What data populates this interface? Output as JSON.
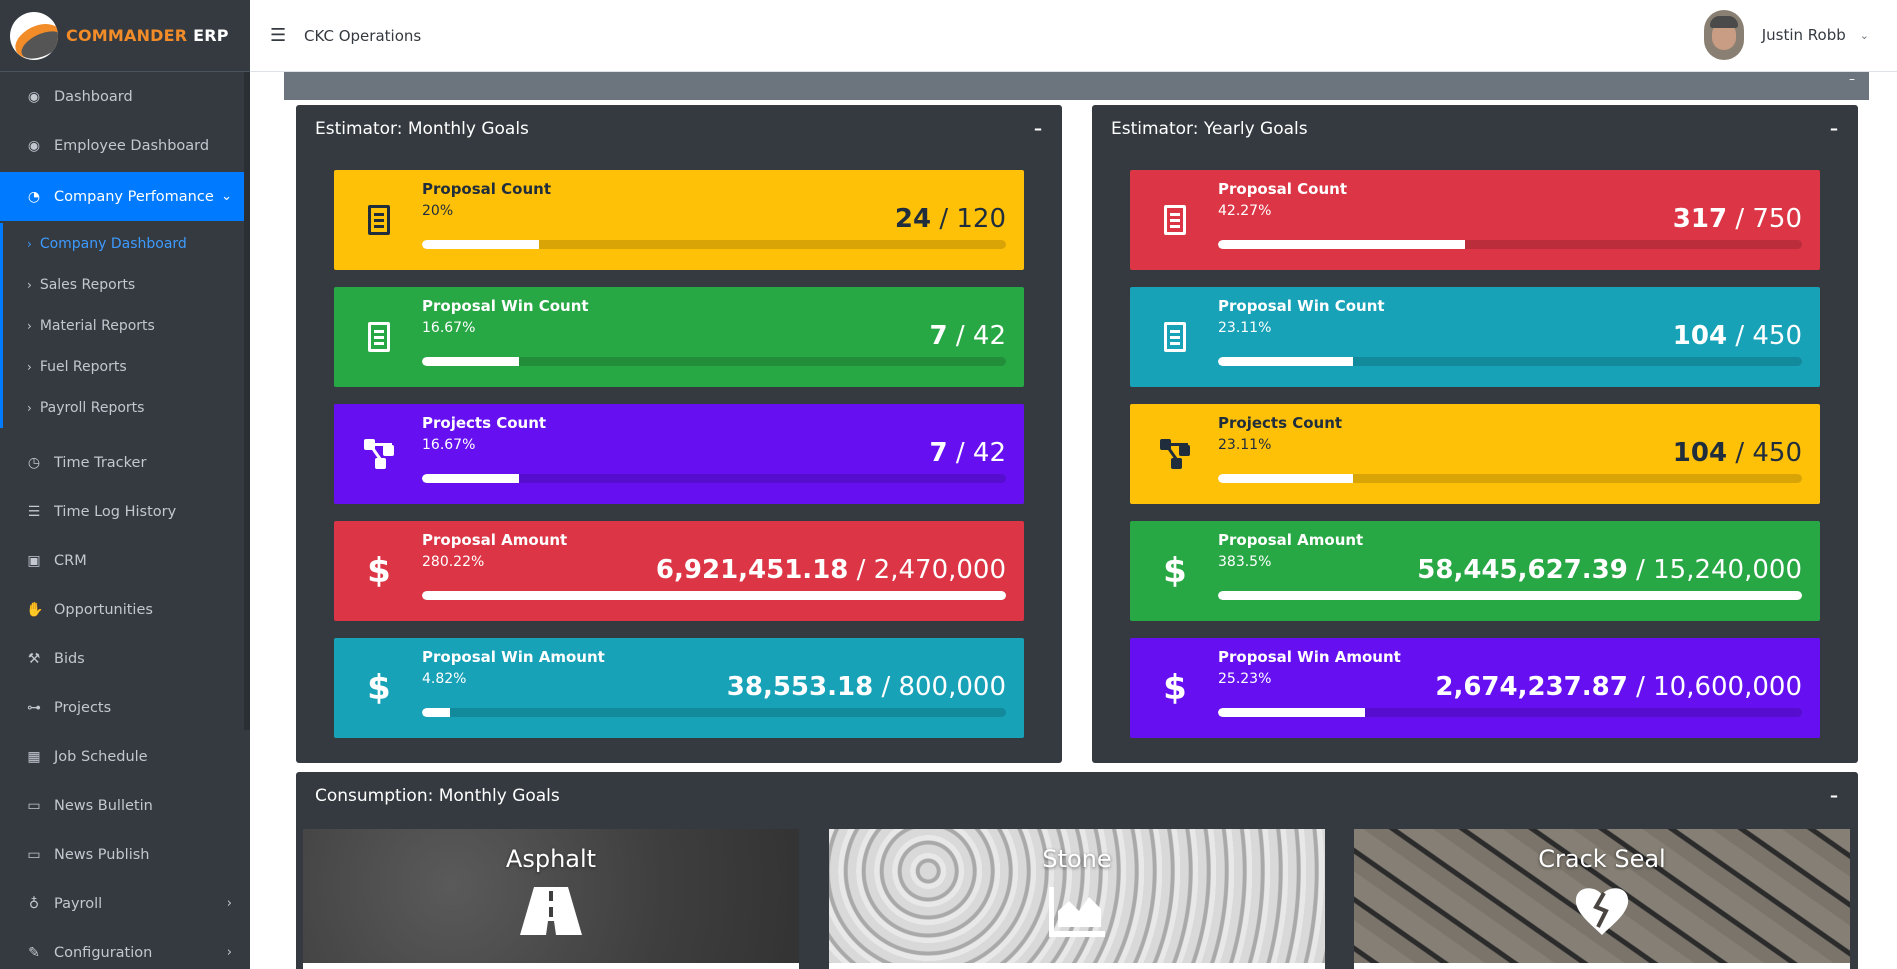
{
  "brand": {
    "name_primary": "COMMANDER",
    "name_secondary": "ERP"
  },
  "header": {
    "menu_icon": "hamburger-icon",
    "title": "CKC Operations",
    "user_name": "Justin Robb"
  },
  "sidebar": {
    "items": [
      {
        "label": "Dashboard",
        "icon": "dashboard-icon"
      },
      {
        "label": "Employee Dashboard",
        "icon": "dashboard-icon"
      },
      {
        "label": "Company Perfomance",
        "icon": "pie-chart-icon",
        "active": true
      },
      {
        "label": "Time Tracker",
        "icon": "clock-icon"
      },
      {
        "label": "Time Log History",
        "icon": "list-icon"
      },
      {
        "label": "CRM",
        "icon": "briefcase-icon"
      },
      {
        "label": "Opportunities",
        "icon": "handshake-icon"
      },
      {
        "label": "Bids",
        "icon": "gavel-icon"
      },
      {
        "label": "Projects",
        "icon": "project-diagram-icon"
      },
      {
        "label": "Job Schedule",
        "icon": "calendar-icon"
      },
      {
        "label": "News Bulletin",
        "icon": "desktop-icon"
      },
      {
        "label": "News Publish",
        "icon": "desktop-icon"
      },
      {
        "label": "Payroll",
        "icon": "money-bag-icon"
      },
      {
        "label": "Configuration",
        "icon": "wrench-icon"
      }
    ],
    "subitems": [
      {
        "label": "Company Dashboard",
        "active": true
      },
      {
        "label": "Sales Reports"
      },
      {
        "label": "Material Reports"
      },
      {
        "label": "Fuel Reports"
      },
      {
        "label": "Payroll Reports"
      }
    ]
  },
  "monthly": {
    "title": "Estimator: Monthly Goals",
    "minimize": "–",
    "goals": [
      {
        "name": "Proposal Count",
        "pct": "20%",
        "current": "24",
        "target": "120",
        "sep": "/",
        "progress": 0.2,
        "color": "#ffc107",
        "icon": "receipt-icon"
      },
      {
        "name": "Proposal Win Count",
        "pct": "16.67%",
        "current": "7",
        "target": "42",
        "sep": "/",
        "progress": 0.1667,
        "color": "#28a745",
        "icon": "receipt-icon"
      },
      {
        "name": "Projects Count",
        "pct": "16.67%",
        "current": "7",
        "target": "42",
        "sep": "/",
        "progress": 0.1667,
        "color": "#6610f2",
        "icon": "project-diagram-icon"
      },
      {
        "name": "Proposal Amount",
        "pct": "280.22%",
        "current": "6,921,451.18",
        "target": "2,470,000",
        "sep": "/",
        "progress": 1.0,
        "color": "#dc3545",
        "icon": "dollar-icon"
      },
      {
        "name": "Proposal Win Amount",
        "pct": "4.82%",
        "current": "38,553.18",
        "target": "800,000",
        "sep": "/",
        "progress": 0.0482,
        "color": "#17a2b8",
        "icon": "dollar-icon"
      }
    ]
  },
  "yearly": {
    "title": "Estimator: Yearly Goals",
    "minimize": "–",
    "goals": [
      {
        "name": "Proposal Count",
        "pct": "42.27%",
        "current": "317",
        "target": "750",
        "sep": "/",
        "progress": 0.4227,
        "color": "#dc3545",
        "icon": "receipt-icon"
      },
      {
        "name": "Proposal Win Count",
        "pct": "23.11%",
        "current": "104",
        "target": "450",
        "sep": "/",
        "progress": 0.2311,
        "color": "#17a2b8",
        "icon": "receipt-icon"
      },
      {
        "name": "Projects Count",
        "pct": "23.11%",
        "current": "104",
        "target": "450",
        "sep": "/",
        "progress": 0.2311,
        "color": "#ffc107",
        "icon": "project-diagram-icon"
      },
      {
        "name": "Proposal Amount",
        "pct": "383.5%",
        "current": "58,445,627.39",
        "target": "15,240,000",
        "sep": "/",
        "progress": 1.0,
        "color": "#28a745",
        "icon": "dollar-icon"
      },
      {
        "name": "Proposal Win Amount",
        "pct": "25.23%",
        "current": "2,674,237.87",
        "target": "10,600,000",
        "sep": "/",
        "progress": 0.2523,
        "color": "#6610f2",
        "icon": "dollar-icon"
      }
    ]
  },
  "consumption": {
    "title": "Consumption: Monthly Goals",
    "minimize": "–",
    "cards": [
      {
        "label": "Asphalt",
        "icon": "road-icon"
      },
      {
        "label": "Stone",
        "icon": "area-chart-icon"
      },
      {
        "label": "Crack Seal",
        "icon": "heart-broken-icon"
      }
    ]
  }
}
